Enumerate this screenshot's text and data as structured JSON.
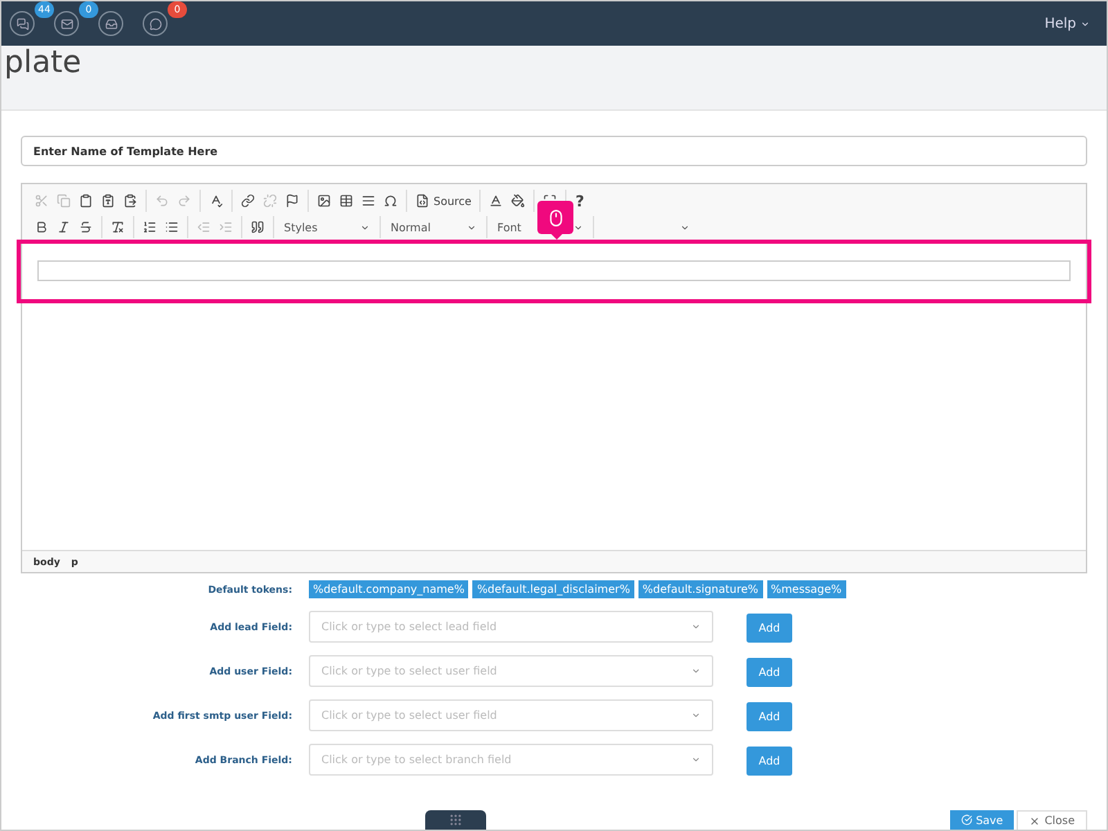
{
  "topbar": {
    "notifications": [
      {
        "kind": "chat",
        "count": "44",
        "color": "#3498db"
      },
      {
        "kind": "mail",
        "count": "0",
        "color": "#3498db"
      },
      {
        "kind": "inbox"
      },
      {
        "kind": "comment",
        "count": "0",
        "color": "#e74c3c"
      }
    ],
    "help": "Help"
  },
  "page_title": "plate",
  "template_name": {
    "placeholder": "Enter Name of Template Here"
  },
  "toolbar": {
    "rows": [
      [
        [
          {
            "kind": "cut",
            "disabled": true
          },
          {
            "kind": "copy",
            "disabled": true
          },
          {
            "kind": "paste",
            "disabled": false
          },
          {
            "kind": "pastetext",
            "disabled": false
          },
          {
            "kind": "pasteword",
            "disabled": false
          }
        ],
        [
          {
            "kind": "undo",
            "disabled": true
          },
          {
            "kind": "redo",
            "disabled": true
          }
        ],
        [
          {
            "kind": "spell",
            "disabled": false
          }
        ],
        [
          {
            "kind": "link",
            "disabled": false
          },
          {
            "kind": "unlink",
            "disabled": true
          },
          {
            "kind": "anchor",
            "disabled": false
          }
        ],
        [
          {
            "kind": "image",
            "disabled": false
          },
          {
            "kind": "table",
            "disabled": false
          },
          {
            "kind": "rule",
            "disabled": false
          },
          {
            "kind": "symbol",
            "disabled": false
          }
        ],
        [
          {
            "kind": "source",
            "label": "Source",
            "disabled": false
          }
        ],
        [
          {
            "kind": "textcolor",
            "disabled": false
          },
          {
            "kind": "bgcolor",
            "disabled": false
          }
        ],
        [
          {
            "kind": "maximize",
            "disabled": false
          }
        ],
        [
          {
            "kind": "help",
            "label": "?",
            "disabled": false
          }
        ]
      ],
      [
        [
          {
            "kind": "bold",
            "disabled": false
          },
          {
            "kind": "italic",
            "disabled": false
          },
          {
            "kind": "strike",
            "disabled": false
          }
        ],
        [
          {
            "kind": "clearformat",
            "disabled": false
          }
        ],
        [
          {
            "kind": "numbered",
            "disabled": false
          },
          {
            "kind": "bulleted",
            "disabled": false
          }
        ],
        [
          {
            "kind": "outdent",
            "disabled": true
          },
          {
            "kind": "indent",
            "disabled": true
          }
        ],
        [
          {
            "kind": "quote",
            "disabled": false
          }
        ],
        [
          {
            "kind": "combo",
            "label": "Styles"
          }
        ],
        [
          {
            "kind": "combo",
            "label": "Normal"
          }
        ],
        [
          {
            "kind": "combo",
            "label": "Font"
          }
        ],
        [
          {
            "kind": "combo"
          }
        ]
      ]
    ]
  },
  "highlight": {
    "kind": "mouse"
  },
  "elements_path": [
    "body",
    "p"
  ],
  "tokens": {
    "label": "Default tokens:",
    "items": [
      "%default.company_name%",
      "%default.legal_disclaimer%",
      "%default.signature%",
      "%message%"
    ]
  },
  "field_rows": [
    {
      "label": "Add lead Field:",
      "placeholder": "Click or type to select lead field",
      "button": "Add"
    },
    {
      "label": "Add user Field:",
      "placeholder": "Click or type to select user field",
      "button": "Add"
    },
    {
      "label": "Add first smtp user Field:",
      "placeholder": "Click or type to select user field",
      "button": "Add"
    },
    {
      "label": "Add Branch Field:",
      "placeholder": "Click or type to select branch field",
      "button": "Add"
    }
  ],
  "footer": {
    "save": "Save",
    "close": "Close"
  }
}
